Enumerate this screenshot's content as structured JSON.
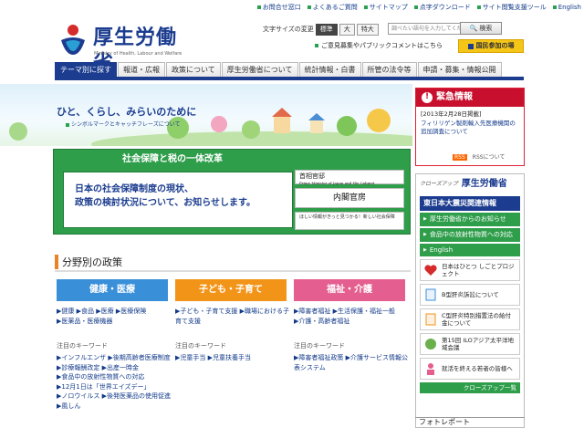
{
  "top_links": [
    "お問合せ窓口",
    "よくあるご質問",
    "サイトマップ",
    "点字ダウンロード",
    "サイト閲覧支援ツール",
    "English"
  ],
  "logo": {
    "jp": "厚生労働省",
    "en": "Ministry of Health, Labour and Welfare"
  },
  "font_size": {
    "label": "文字サイズの変更",
    "options": [
      "標準",
      "大",
      "特大"
    ],
    "selected": "標準"
  },
  "search": {
    "placeholder": "調べたい語句を入力してください",
    "button": "検索"
  },
  "opinion_link": "ご意見募集やパブリックコメントはこちら",
  "kokumin_button": "国民参加の場",
  "nav": [
    "テーマ別に探す",
    "報道・広報",
    "政策について",
    "厚生労働省について",
    "統計情報・白書",
    "所管の法令等",
    "申請・募集・情報公開"
  ],
  "hero": {
    "slogan": "ひと、くらし、みらいのために",
    "sub": "シンボルマークとキャッチフレーズについて"
  },
  "banner": {
    "title": "社会保障と税の一体改革",
    "body_line1": "日本の社会保障制度の現状、",
    "body_line2": "政策の検討状況について、お知らせします。",
    "kantei": "首相官邸",
    "kantei_en": "Prime Minister of Japan and His Cabinet",
    "naikaku": "内閣官房",
    "small": "ほしい情報がきっと見つかる！新しい社会保障"
  },
  "policy": {
    "title": "分野別の政策",
    "categories": [
      {
        "name": "健康・医療",
        "color": "#3a8fd9",
        "links": [
          "健康",
          "食品",
          "医療",
          "医療保険",
          "医薬品・医療機器"
        ],
        "kw_label": "注目のキーワード",
        "keywords": [
          "インフルエンザ",
          "後期高齢者医療制度",
          "診療報酬改定",
          "出産一時金",
          "食品中の放射性物質への対応",
          "12月1日は「世界エイズデー」",
          "ノロウイルス",
          "後発医薬品の使用促進",
          "風しん"
        ]
      },
      {
        "name": "子ども・子育て",
        "color": "#f29418",
        "links": [
          "子ども・子育て支援",
          "職場における子育て支援"
        ],
        "kw_label": "注目のキーワード",
        "keywords": [
          "児童手当",
          "児童扶養手当"
        ]
      },
      {
        "name": "福祉・介護",
        "color": "#e45f8f",
        "links": [
          "障害者福祉",
          "生活保護・福祉一般",
          "介護・高齢者福祉"
        ],
        "kw_label": "注目のキーワード",
        "keywords": [
          "障害者福祉政策",
          "介護サービス情報公表システム"
        ]
      }
    ]
  },
  "emergency": {
    "title": "緊急情報",
    "date": "[2013年2月28日掲載]",
    "item": "フィリリゲン製剤輸入先医療機関の追加調査について",
    "rss": [
      "RSS",
      "RSSについて"
    ]
  },
  "closeup": {
    "tag": "クローズアップ",
    "title": "厚生労働省",
    "subhead": "東日本大震災関連情報",
    "buttons": [
      "厚生労働省からのお知らせ",
      "食品中の放射性物質への対応",
      "English"
    ],
    "banners": [
      "日本はひとつ しごとプロジェクト",
      "B型肝炎訴訟について",
      "C型肝炎特別措置法の給付金について",
      "第15回 ILOアジア太平洋地域会議",
      "就活を終える若者の皆様へ"
    ],
    "more": "クローズアップ一覧"
  },
  "photo_report": "フォトレポート",
  "colors": {
    "brand": "#1b3c8f",
    "green": "#2f9e4b",
    "red": "#c8102e",
    "yellow": "#f5c518"
  }
}
